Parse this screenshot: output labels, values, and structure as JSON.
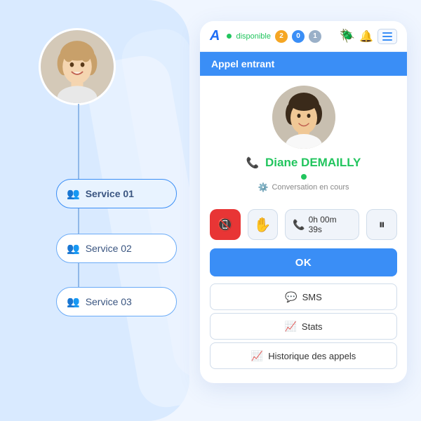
{
  "header": {
    "logo_text": "A",
    "status_label": "disponible",
    "badge_yellow": "2",
    "badge_blue": "0",
    "badge_gray": "1"
  },
  "appel_bar": {
    "label": "Appel entrant"
  },
  "caller": {
    "name": "Diane DEMAILLY",
    "status": "Conversation en cours",
    "timer": "0h 00m 39s"
  },
  "buttons": {
    "ok_label": "OK",
    "sms_label": "SMS",
    "stats_label": "Stats",
    "history_label": "Historique des appels"
  },
  "services": {
    "service1": "Service  01",
    "service2": "Service  02",
    "service3": "Service  03"
  }
}
